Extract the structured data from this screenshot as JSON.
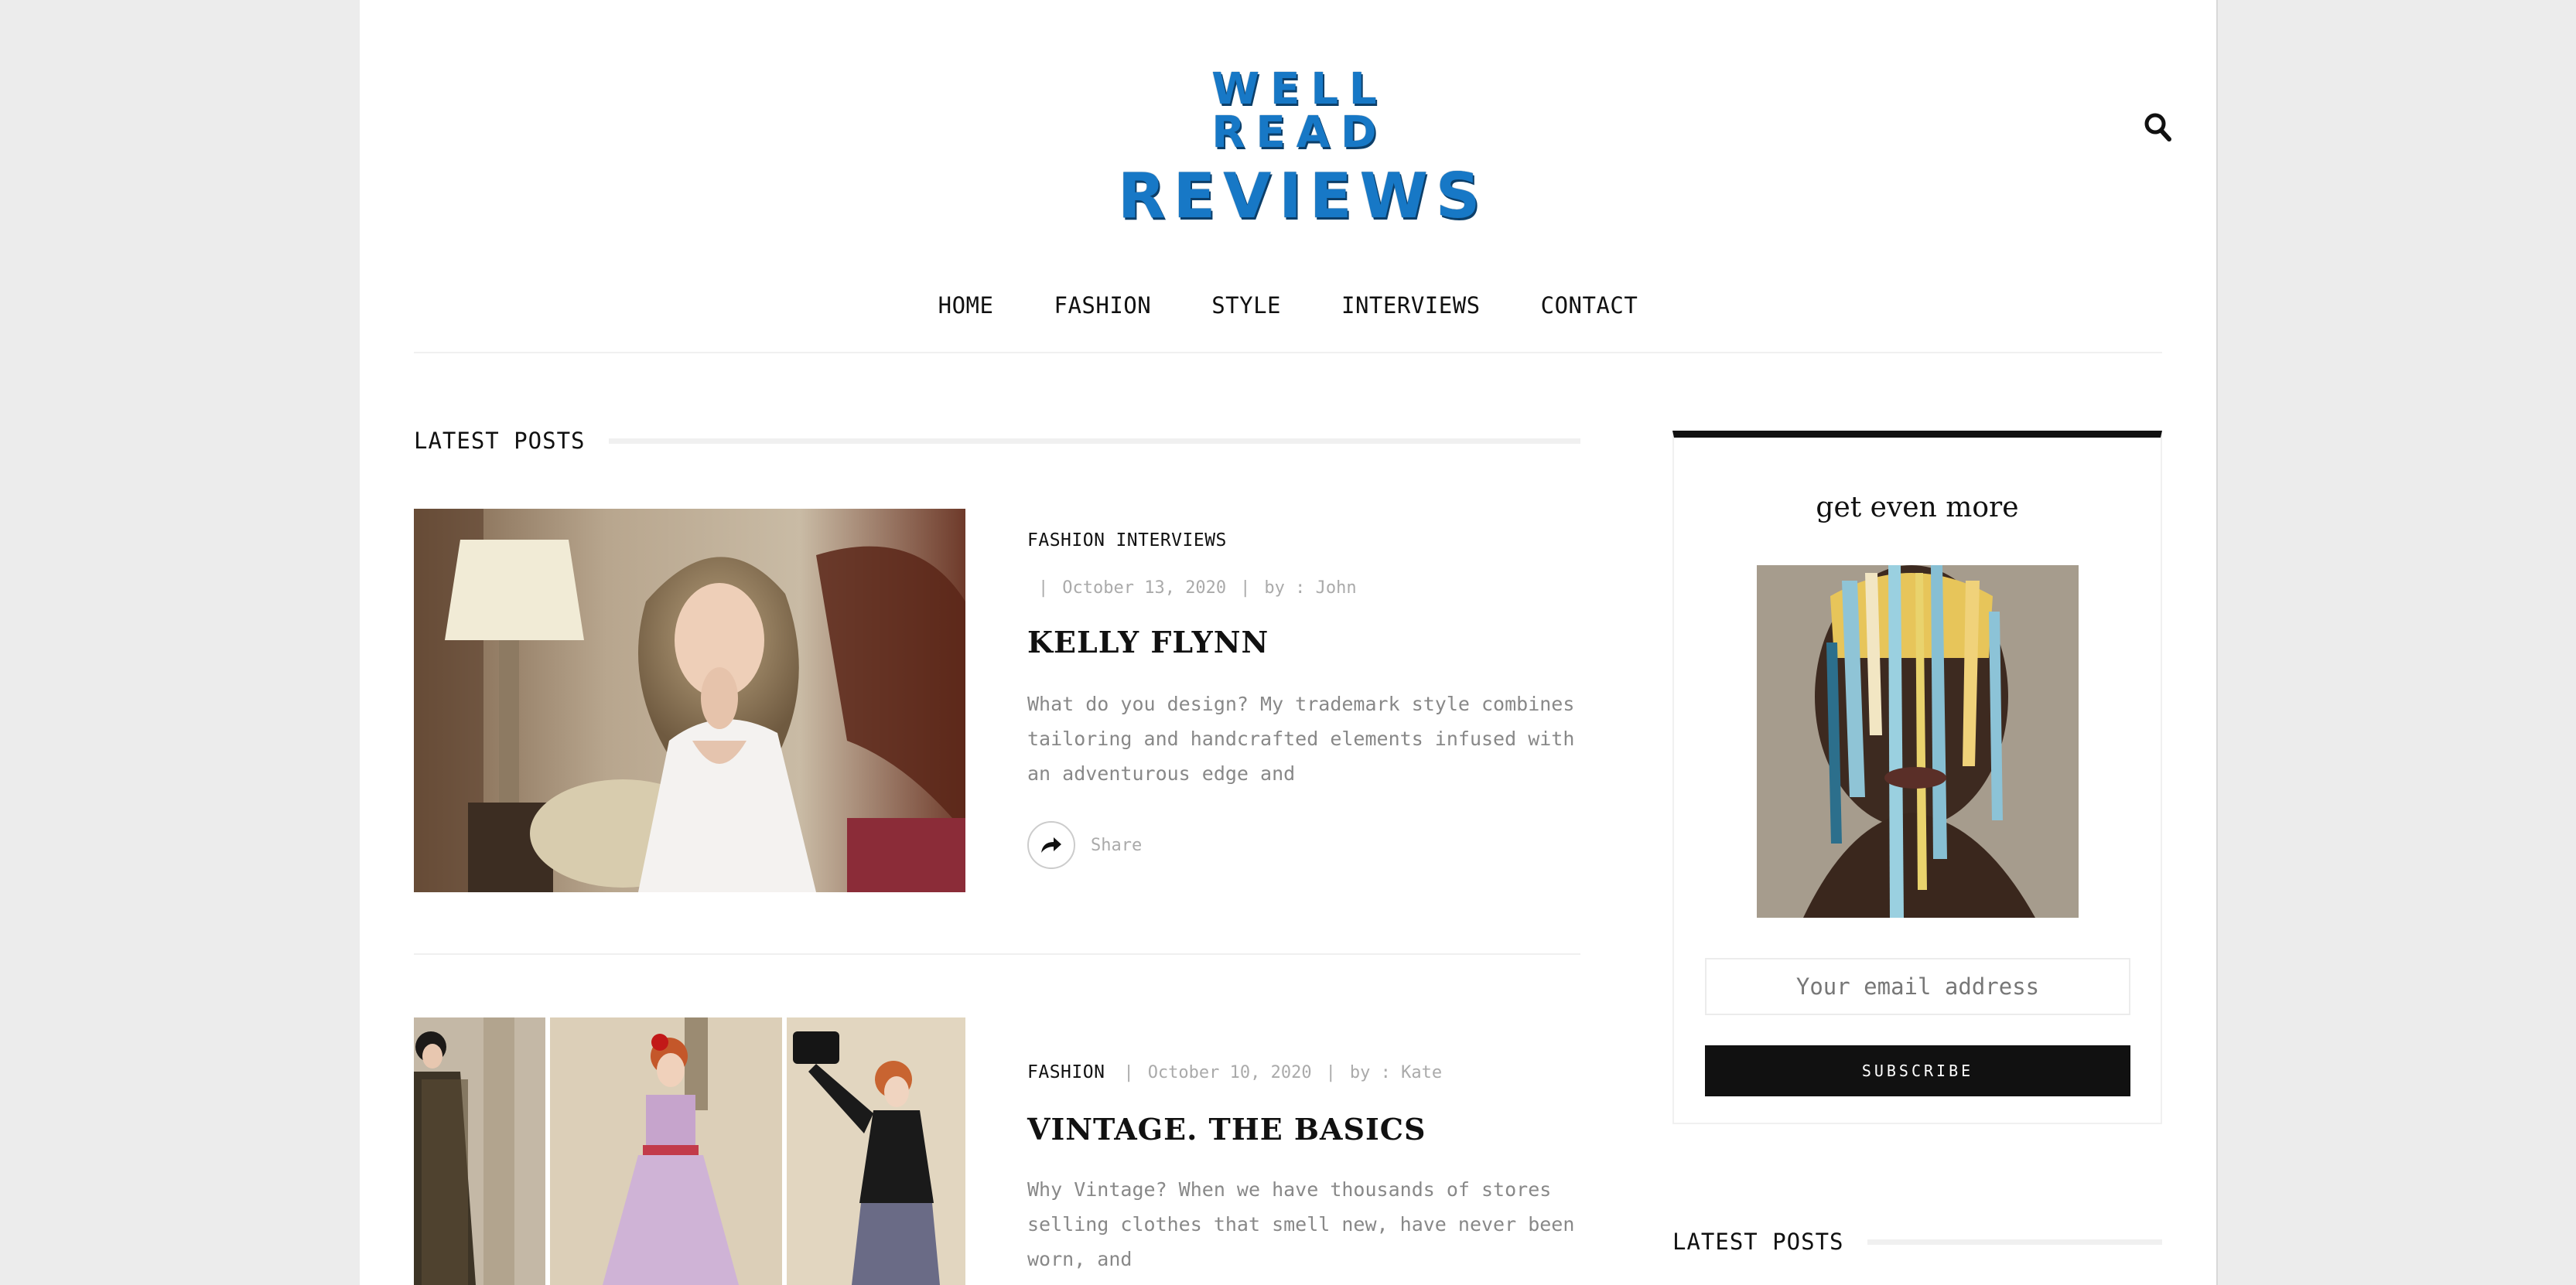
{
  "header": {
    "logo_line1": "WELL READ",
    "logo_line2": "REVIEWS",
    "search_icon": "search-icon"
  },
  "nav": {
    "items": [
      {
        "label": "HOME"
      },
      {
        "label": "FASHION"
      },
      {
        "label": "STYLE"
      },
      {
        "label": "INTERVIEWS"
      },
      {
        "label": "CONTACT"
      }
    ]
  },
  "main": {
    "section_title": "LATEST POSTS",
    "posts": [
      {
        "categories": [
          "FASHION",
          "INTERVIEWS"
        ],
        "date": "October 13, 2020",
        "author": "by : John",
        "title": "KELLY FLYNN",
        "excerpt": "What do you design?   My trademark style combines tailoring and handcrafted elements infused with an adventurous edge and",
        "share_label": "Share"
      },
      {
        "categories": [
          "FASHION"
        ],
        "date": "October 10, 2020",
        "author": "by : Kate",
        "title": "VINTAGE. THE BASICS",
        "excerpt": "Why Vintage? When we have thousands of stores selling clothes that smell new, have never been worn, and"
      }
    ]
  },
  "sidebar": {
    "widget_title": "get even more",
    "email_placeholder": "Your email address",
    "subscribe_label": "SUBSCRIBE",
    "latest_title": "LATEST POSTS"
  },
  "colors": {
    "accent_logo": "#1778c6",
    "background": "#ececec",
    "dark": "#111111"
  }
}
